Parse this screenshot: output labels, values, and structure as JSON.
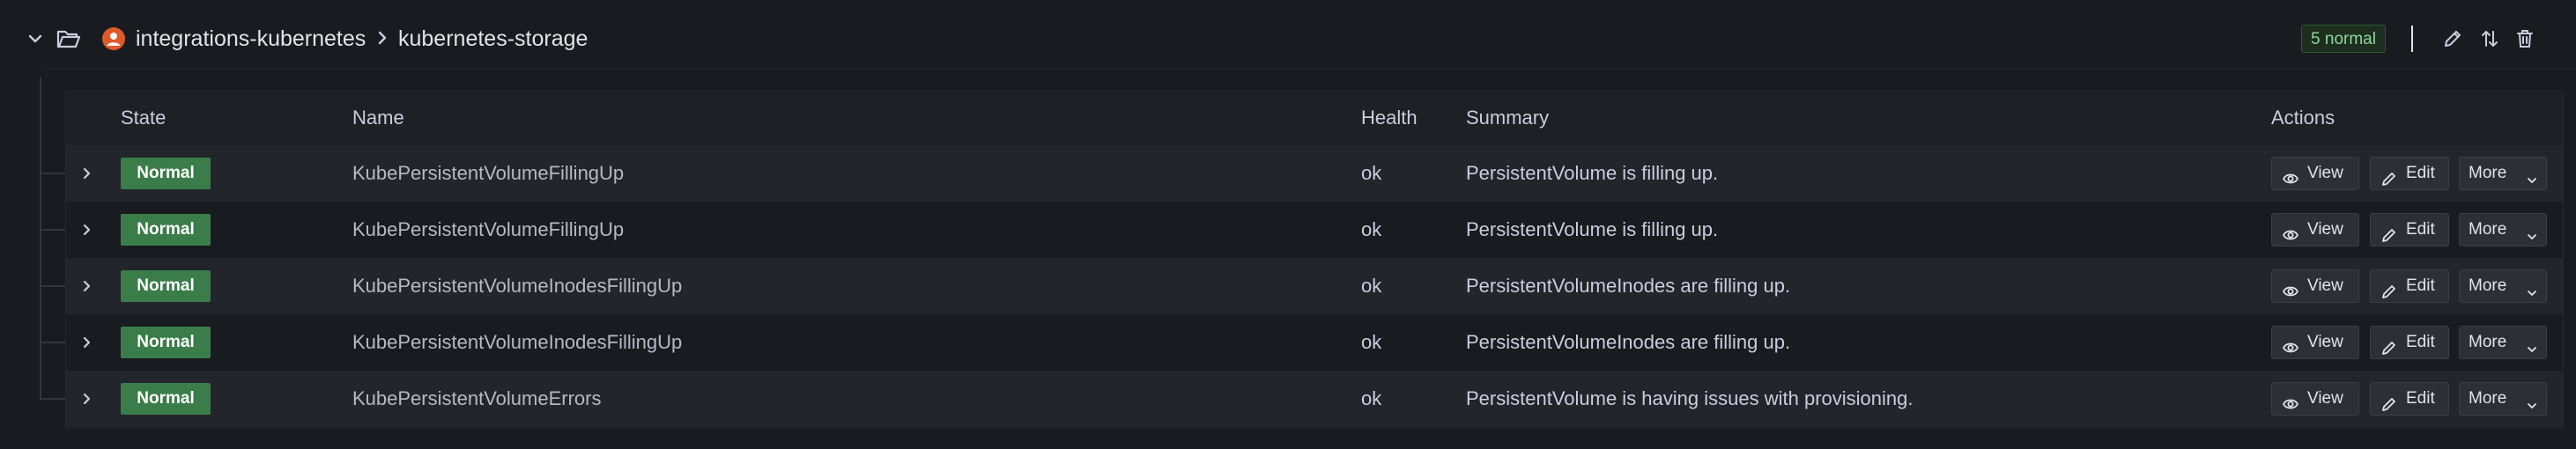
{
  "header": {
    "namespace": "integrations-kubernetes",
    "group": "kubernetes-storage",
    "state_count": "5 normal",
    "icons": {
      "collapse": "chevron-down-icon",
      "folder": "folder-open-icon",
      "namespace": "grafana-icon",
      "separator": "chevron-right-icon",
      "edit": "pencil-icon",
      "reorder": "sort-arrows-icon",
      "delete": "trash-icon"
    }
  },
  "table": {
    "columns": [
      "State",
      "Name",
      "Health",
      "Summary",
      "Actions"
    ],
    "rows": [
      {
        "state": "Normal",
        "name": "KubePersistentVolumeFillingUp",
        "health": "ok",
        "summary": "PersistentVolume is filling up."
      },
      {
        "state": "Normal",
        "name": "KubePersistentVolumeFillingUp",
        "health": "ok",
        "summary": "PersistentVolume is filling up."
      },
      {
        "state": "Normal",
        "name": "KubePersistentVolumeInodesFillingUp",
        "health": "ok",
        "summary": "PersistentVolumeInodes are filling up."
      },
      {
        "state": "Normal",
        "name": "KubePersistentVolumeInodesFillingUp",
        "health": "ok",
        "summary": "PersistentVolumeInodes are filling up."
      },
      {
        "state": "Normal",
        "name": "KubePersistentVolumeErrors",
        "health": "ok",
        "summary": "PersistentVolume is having issues with provisioning."
      }
    ],
    "actions": {
      "view_label": "View",
      "edit_label": "Edit",
      "more_label": "More"
    }
  },
  "colors": {
    "background": "#181b1f",
    "row_alt": "#22252b",
    "normal_badge": "#3a7d4a",
    "state_count_text": "#8fd49b"
  }
}
